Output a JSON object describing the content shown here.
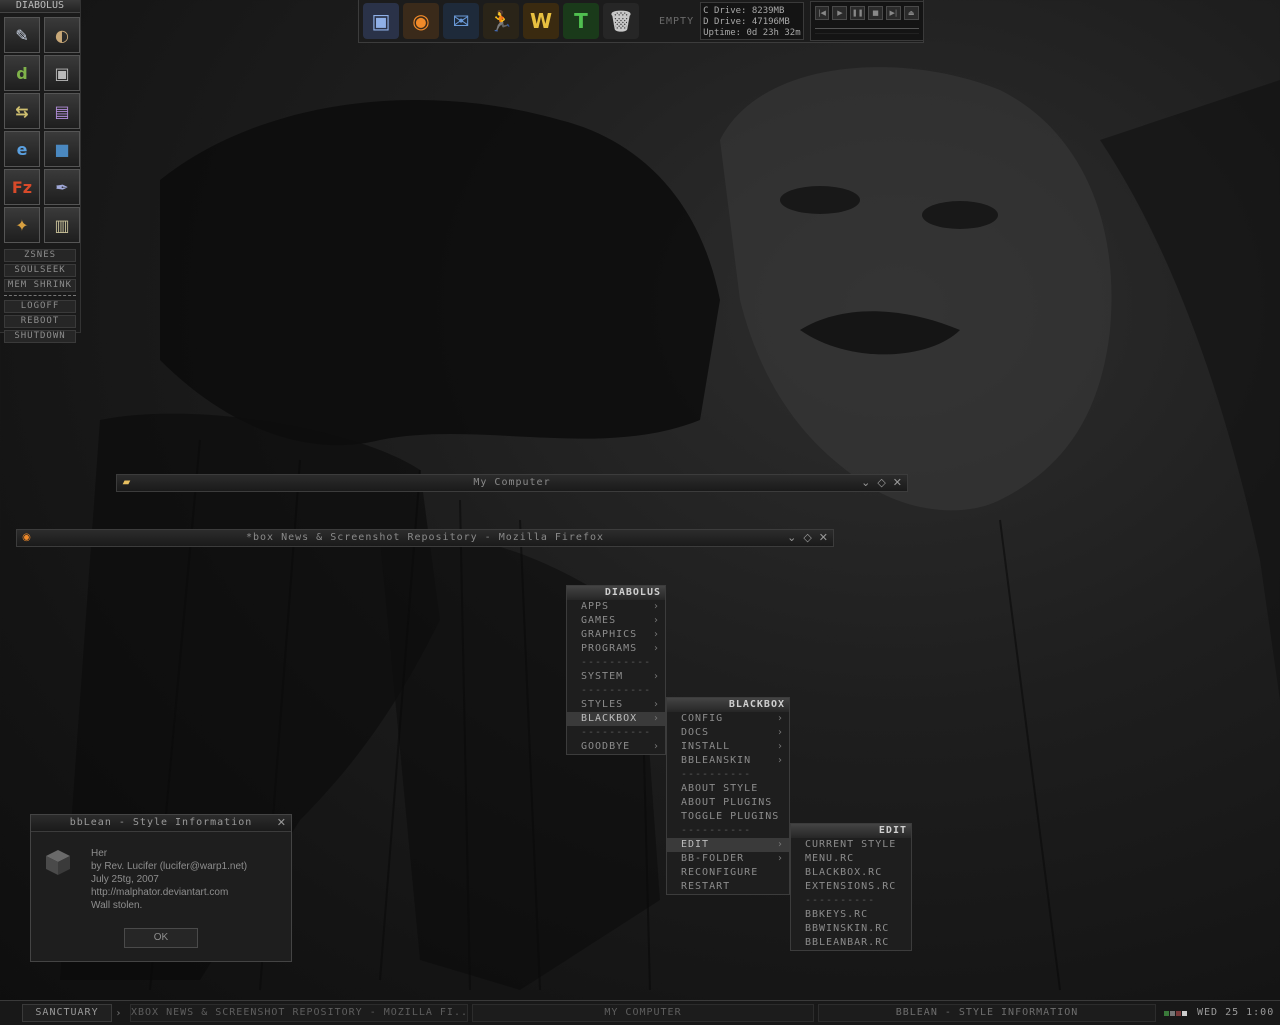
{
  "slit": {
    "title": "DIABOLUS",
    "icons": [
      {
        "name": "quill-icon",
        "glyph": "✎",
        "color": "#cfd8e8"
      },
      {
        "name": "palette-icon",
        "glyph": "◐",
        "color": "#c8a878"
      },
      {
        "name": "dreamweaver-icon",
        "glyph": "d",
        "color": "#7fb24a"
      },
      {
        "name": "image-viewer-icon",
        "glyph": "▣",
        "color": "#b8b8b8"
      },
      {
        "name": "resize-tool-icon",
        "glyph": "⇆",
        "color": "#d0c070"
      },
      {
        "name": "notepad-icon",
        "glyph": "▤",
        "color": "#b08cd8"
      },
      {
        "name": "internet-explorer-icon",
        "glyph": "e",
        "color": "#5aa0e0"
      },
      {
        "name": "image-editor-icon",
        "glyph": "■",
        "color": "#4a88c0"
      },
      {
        "name": "filezilla-icon",
        "glyph": "Fz",
        "color": "#d84a2a"
      },
      {
        "name": "pen-tool-icon",
        "glyph": "✒",
        "color": "#a0a8d8"
      },
      {
        "name": "compass-icon",
        "glyph": "✦",
        "color": "#d8a040"
      },
      {
        "name": "archive-icon",
        "glyph": "▥",
        "color": "#c8c098"
      }
    ],
    "items_a": [
      "ZSNES",
      "SOULSEEK",
      "MEM SHRINK"
    ],
    "items_b": [
      "LOGOFF",
      "REBOOT",
      "SHUTDOWN"
    ]
  },
  "toolbar": {
    "icons": [
      {
        "name": "my-computer-icon",
        "glyph": "▣",
        "color": "#8fb0e8",
        "bg": "#2a3248"
      },
      {
        "name": "firefox-icon",
        "glyph": "◉",
        "color": "#f08a2a",
        "bg": "#3a2a1a"
      },
      {
        "name": "thunderbird-icon",
        "glyph": "✉",
        "color": "#6a9ad8",
        "bg": "#1e2a3a"
      },
      {
        "name": "aim-icon",
        "glyph": "🏃",
        "color": "#f0b020",
        "bg": "#2a2418"
      },
      {
        "name": "world-of-warcraft-icon",
        "glyph": "W",
        "color": "#e8c040",
        "bg": "#3a2a10"
      },
      {
        "name": "test-icon",
        "glyph": "T",
        "color": "#50c050",
        "bg": "#1a3a1a"
      },
      {
        "name": "recycle-bin-icon",
        "glyph": "🗑",
        "color": "#c8c8c8",
        "bg": "#262626"
      }
    ],
    "bin_status": "EMPTY",
    "drives": [
      "C Drive: 8239MB",
      "D Drive: 47196MB",
      "Uptime: 0d 23h 32m"
    ],
    "player_buttons": [
      "|◀",
      "▶",
      "❚❚",
      "■",
      "▶|",
      "⏏"
    ]
  },
  "windows": {
    "my_computer": {
      "title": "My Computer"
    },
    "firefox": {
      "title": "*box News & Screenshot Repository - Mozilla Firefox"
    },
    "controls": [
      "⌄",
      "◇",
      "✕"
    ]
  },
  "menus": {
    "root": {
      "title": "DIABOLUS",
      "items": [
        {
          "label": "APPS",
          "type": "sub"
        },
        {
          "label": "GAMES",
          "type": "sub"
        },
        {
          "label": "GRAPHICS",
          "type": "sub"
        },
        {
          "label": "PROGRAMS",
          "type": "sub"
        },
        {
          "label": "----------",
          "type": "sep"
        },
        {
          "label": "SYSTEM",
          "type": "sub"
        },
        {
          "label": "----------",
          "type": "sep"
        },
        {
          "label": "STYLES",
          "type": "sub"
        },
        {
          "label": "BLACKBOX",
          "type": "active"
        },
        {
          "label": "----------",
          "type": "sep"
        },
        {
          "label": "GOODBYE",
          "type": "sub"
        }
      ]
    },
    "blackbox": {
      "title": "BLACKBOX",
      "items": [
        {
          "label": "CONFIG",
          "type": "sub"
        },
        {
          "label": "DOCS",
          "type": "sub"
        },
        {
          "label": "INSTALL",
          "type": "sub"
        },
        {
          "label": "BBLEANSKIN",
          "type": "sub"
        },
        {
          "label": "----------",
          "type": "sep"
        },
        {
          "label": "ABOUT STYLE",
          "type": "item"
        },
        {
          "label": "ABOUT PLUGINS",
          "type": "item"
        },
        {
          "label": "TOGGLE PLUGINS",
          "type": "item"
        },
        {
          "label": "----------",
          "type": "sep"
        },
        {
          "label": "EDIT",
          "type": "active"
        },
        {
          "label": "BB-FOLDER",
          "type": "sub"
        },
        {
          "label": "RECONFIGURE",
          "type": "item"
        },
        {
          "label": "RESTART",
          "type": "item"
        }
      ]
    },
    "edit": {
      "title": "EDIT",
      "items": [
        {
          "label": "CURRENT STYLE",
          "type": "item"
        },
        {
          "label": "MENU.RC",
          "type": "item"
        },
        {
          "label": "BLACKBOX.RC",
          "type": "item"
        },
        {
          "label": "EXTENSIONS.RC",
          "type": "item"
        },
        {
          "label": "----------",
          "type": "sep"
        },
        {
          "label": "BBKEYS.RC",
          "type": "item"
        },
        {
          "label": "BBWINSKIN.RC",
          "type": "item"
        },
        {
          "label": "BBLEANBAR.RC",
          "type": "item"
        }
      ]
    }
  },
  "dialog": {
    "title": "bbLean - Style Information",
    "lines": [
      "Her",
      "by Rev. Lucifer (lucifer@warp1.net)",
      "July 25tg, 2007",
      "http://malphator.deviantart.com",
      "Wall stolen."
    ],
    "ok_label": "OK",
    "close": "✕"
  },
  "taskbar": {
    "workspace": "SANCTUARY",
    "arrow": "›",
    "tasks": [
      {
        "label": "XBOX NEWS & SCREENSHOT REPOSITORY - MOZILLA FI...",
        "current": false
      },
      {
        "label": "MY COMPUTER",
        "current": false
      },
      {
        "label": "BBLEAN - STYLE INFORMATION",
        "current": true
      }
    ],
    "tray_colors": [
      "#3a7a3a",
      "#777777",
      "#7a3a3a",
      "#cccccc"
    ],
    "clock": "WED 25 1:00"
  }
}
